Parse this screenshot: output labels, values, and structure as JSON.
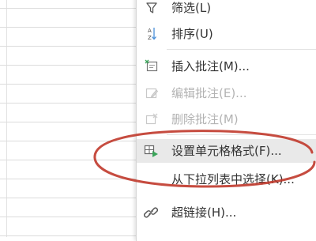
{
  "menu": {
    "items": [
      {
        "label": "筛选(L)",
        "icon": "funnel-icon",
        "enabled": true
      },
      {
        "label": "排序(U)",
        "icon": "sort-az-icon",
        "enabled": true
      },
      {
        "label": "插入批注(M)...",
        "icon": "insert-comment-icon",
        "enabled": true
      },
      {
        "label": "编辑批注(E)...",
        "icon": "edit-comment-icon",
        "enabled": false
      },
      {
        "label": "删除批注(M)",
        "icon": "delete-comment-icon",
        "enabled": false
      },
      {
        "label": "设置单元格格式(F)...",
        "icon": "format-cells-icon",
        "enabled": true,
        "highlighted": true
      },
      {
        "label": "从下拉列表中选择(K)...",
        "icon": "",
        "enabled": true
      },
      {
        "label": "超链接(H)...",
        "icon": "hyperlink-icon",
        "enabled": true
      }
    ]
  },
  "colors": {
    "annotation": "#c0392b",
    "highlight": "#e9e9e9",
    "text": "#333333",
    "disabled_text": "#b3b3b3"
  }
}
